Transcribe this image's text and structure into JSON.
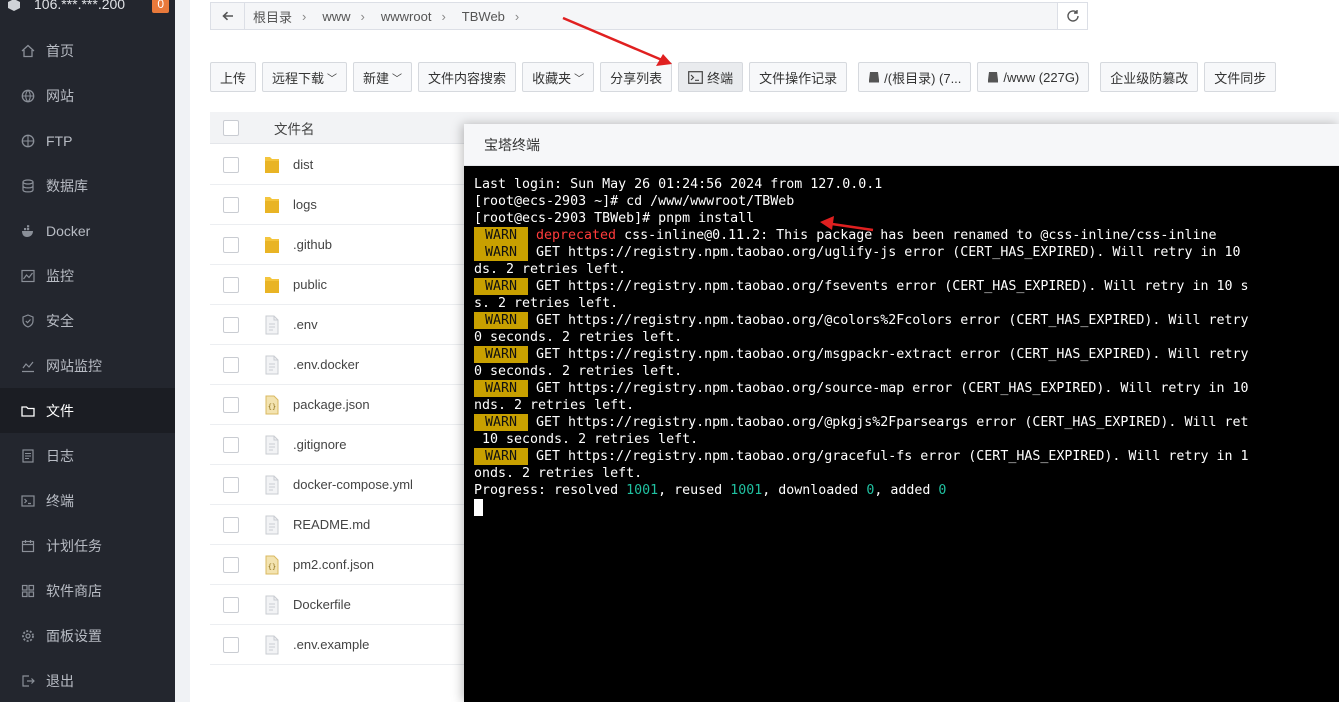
{
  "server": {
    "ip": "106.***.***.200",
    "badge": "0"
  },
  "sidebar": {
    "items": [
      {
        "label": "首页",
        "icon": "home-icon"
      },
      {
        "label": "网站",
        "icon": "globe-icon"
      },
      {
        "label": "FTP",
        "icon": "ftp-icon"
      },
      {
        "label": "数据库",
        "icon": "database-icon"
      },
      {
        "label": "Docker",
        "icon": "docker-icon"
      },
      {
        "label": "监控",
        "icon": "monitor-icon"
      },
      {
        "label": "安全",
        "icon": "shield-icon"
      },
      {
        "label": "网站监控",
        "icon": "chart-icon"
      },
      {
        "label": "文件",
        "icon": "folder-icon",
        "active": true
      },
      {
        "label": "日志",
        "icon": "log-icon"
      },
      {
        "label": "终端",
        "icon": "terminal-icon"
      },
      {
        "label": "计划任务",
        "icon": "calendar-icon"
      },
      {
        "label": "软件商店",
        "icon": "apps-icon"
      },
      {
        "label": "面板设置",
        "icon": "gear-icon"
      },
      {
        "label": "退出",
        "icon": "logout-icon"
      }
    ]
  },
  "pathbar": {
    "crumbs": [
      "根目录",
      "www",
      "wwwroot",
      "TBWeb"
    ]
  },
  "toolbar": {
    "upload": "上传",
    "remote_download": "远程下载",
    "new": "新建",
    "content_search": "文件内容搜索",
    "favorites": "收藏夹",
    "share_list": "分享列表",
    "terminal": "终端",
    "op_log": "文件操作记录",
    "disk_root": "/(根目录) (7...",
    "disk_www": "/www (227G)",
    "tamper": "企业级防篡改",
    "sync": "文件同步"
  },
  "table": {
    "header_name": "文件名",
    "files": [
      {
        "name": "dist",
        "type": "folder"
      },
      {
        "name": "logs",
        "type": "folder"
      },
      {
        "name": ".github",
        "type": "folder"
      },
      {
        "name": "public",
        "type": "folder"
      },
      {
        "name": ".env",
        "type": "file"
      },
      {
        "name": ".env.docker",
        "type": "file"
      },
      {
        "name": "package.json",
        "type": "json"
      },
      {
        "name": ".gitignore",
        "type": "file"
      },
      {
        "name": "docker-compose.yml",
        "type": "file"
      },
      {
        "name": "README.md",
        "type": "file"
      },
      {
        "name": "pm2.conf.json",
        "type": "json"
      },
      {
        "name": "Dockerfile",
        "type": "file"
      },
      {
        "name": ".env.example",
        "type": "file"
      }
    ]
  },
  "dialog": {
    "title": "宝塔终端"
  },
  "terminal": {
    "line1": "Last login: Sun May 26 01:24:56 2024 from 127.0.0.1",
    "line2": "[root@ecs-2903 ~]# cd /www/wwwroot/TBWeb",
    "line3": "[root@ecs-2903 TBWeb]# pnpm install",
    "warn": "WARN",
    "dep_word": "deprecated",
    "dep_rest": " css-inline@0.11.2: This package has been renamed to @css-inline/css-inline",
    "w1a": "GET https://registry.npm.taobao.org/uglify-js error (CERT_HAS_EXPIRED). Will retry in 10",
    "w1b": "ds. 2 retries left.",
    "w2a": "GET https://registry.npm.taobao.org/fsevents error (CERT_HAS_EXPIRED). Will retry in 10 s",
    "w2b": "s. 2 retries left.",
    "w3a": "GET https://registry.npm.taobao.org/@colors%2Fcolors error (CERT_HAS_EXPIRED). Will retry",
    "w3b": "0 seconds. 2 retries left.",
    "w4a": "GET https://registry.npm.taobao.org/msgpackr-extract error (CERT_HAS_EXPIRED). Will retry",
    "w4b": "0 seconds. 2 retries left.",
    "w5a": "GET https://registry.npm.taobao.org/source-map error (CERT_HAS_EXPIRED). Will retry in 10",
    "w5b": "nds. 2 retries left.",
    "w6a": "GET https://registry.npm.taobao.org/@pkgjs%2Fparseargs error (CERT_HAS_EXPIRED). Will ret",
    "w6b": " 10 seconds. 2 retries left.",
    "w7a": "GET https://registry.npm.taobao.org/graceful-fs error (CERT_HAS_EXPIRED). Will retry in 1",
    "w7b": "onds. 2 retries left.",
    "progress_label": "Progress: resolved ",
    "resolved": "1001",
    "reused_label": ", reused ",
    "reused": "1001",
    "downloaded_label": ", downloaded ",
    "downloaded": "0",
    "added_label": ", added ",
    "added": "0"
  },
  "colors": {
    "accent_red": "#e02020",
    "warn_bg": "#c8a000",
    "sidebar_bg": "#23262e"
  }
}
